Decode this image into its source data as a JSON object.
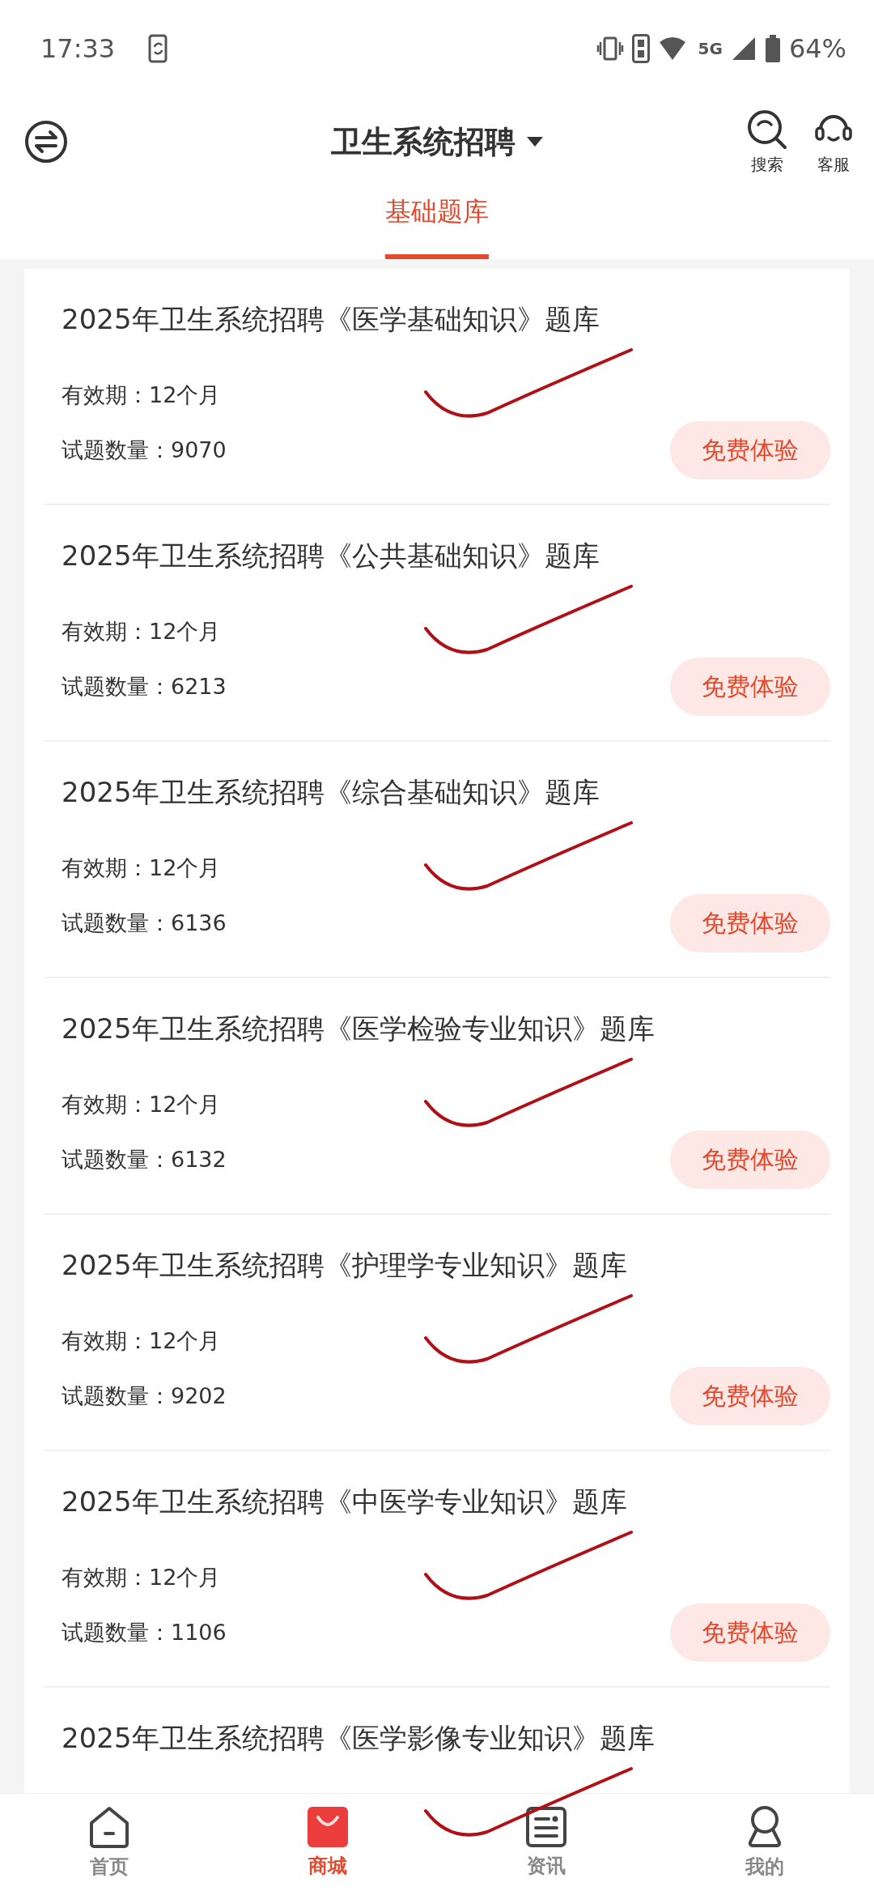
{
  "status_bar": {
    "time": "17:33",
    "battery": "64%",
    "network": "5G"
  },
  "header": {
    "title": "卫生系统招聘",
    "actions": [
      {
        "label": "搜索",
        "kind": "search"
      },
      {
        "label": "客服",
        "kind": "support"
      }
    ]
  },
  "tabs": [
    {
      "label": "基础题库",
      "selected": true
    }
  ],
  "items": [
    {
      "title": "2025年卫生系统招聘《医学基础知识》题库",
      "validity": "有效期：12个月",
      "count": "试题数量：9070",
      "button": "免费体验",
      "marked": true
    },
    {
      "title": "2025年卫生系统招聘《公共基础知识》题库",
      "validity": "有效期：12个月",
      "count": "试题数量：6213",
      "button": "免费体验",
      "marked": true
    },
    {
      "title": "2025年卫生系统招聘《综合基础知识》题库",
      "validity": "有效期：12个月",
      "count": "试题数量：6136",
      "button": "免费体验",
      "marked": true
    },
    {
      "title": "2025年卫生系统招聘《医学检验专业知识》题库",
      "validity": "有效期：12个月",
      "count": "试题数量：6132",
      "button": "免费体验",
      "marked": true
    },
    {
      "title": "2025年卫生系统招聘《护理学专业知识》题库",
      "validity": "有效期：12个月",
      "count": "试题数量：9202",
      "button": "免费体验",
      "marked": true
    },
    {
      "title": "2025年卫生系统招聘《中医学专业知识》题库",
      "validity": "有效期：12个月",
      "count": "试题数量：1106",
      "button": "免费体验",
      "marked": true
    },
    {
      "title": "2025年卫生系统招聘《医学影像专业知识》题库",
      "marked": true
    }
  ],
  "bottom_nav": [
    {
      "label": "首页",
      "kind": "home",
      "selected": false
    },
    {
      "label": "商城",
      "kind": "shop",
      "selected": true
    },
    {
      "label": "资讯",
      "kind": "news",
      "selected": false
    },
    {
      "label": "我的",
      "kind": "profile",
      "selected": false
    }
  ]
}
